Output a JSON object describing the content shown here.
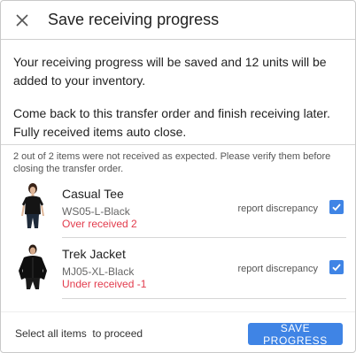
{
  "dialog": {
    "title": "Save receiving progress",
    "close_icon": "close-icon",
    "message_line1": "Your receiving progress will be saved and 12 units will be added to your inventory.",
    "message_line2": "Come back to this transfer order and finish receiving later. Fully received items auto close.",
    "notice": "2 out of 2 items were not received as expected. Please verify them before closing the transfer order."
  },
  "items": [
    {
      "name": "Casual Tee",
      "sku": "WS05-L-Black",
      "status": "Over received 2",
      "report_label": "report discrepancy",
      "checked": true,
      "thumbnail_icon": "tee-shirt-model-image"
    },
    {
      "name": "Trek Jacket",
      "sku": "MJ05-XL-Black",
      "status": "Under received -1",
      "report_label": "report discrepancy",
      "checked": true,
      "thumbnail_icon": "jacket-model-image"
    }
  ],
  "footer": {
    "hint": "Select all items  to proceed",
    "save_label": "SAVE PROGRESS"
  },
  "colors": {
    "accent": "#3f84e5",
    "error": "#e23b4c"
  }
}
